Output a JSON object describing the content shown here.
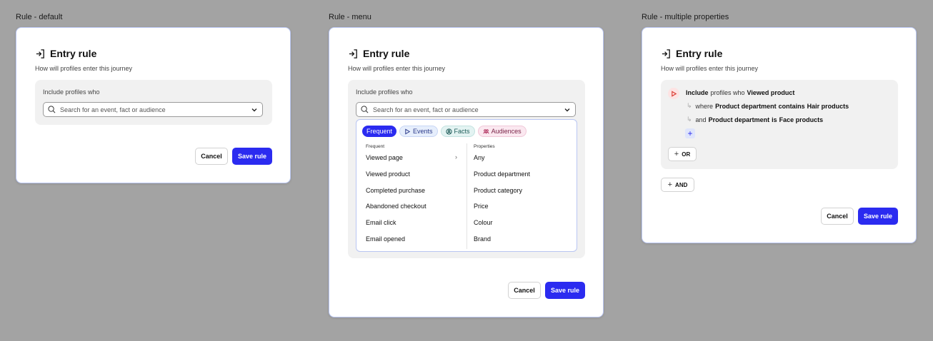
{
  "frames": [
    {
      "label": "Rule - default"
    },
    {
      "label": "Rule - menu"
    },
    {
      "label": "Rule - multiple properties"
    }
  ],
  "rule": {
    "title": "Entry rule",
    "subtitle": "How will profiles enter this journey",
    "include_label": "Include profiles who",
    "search_placeholder": "Search for an event, fact or audience",
    "cancel_label": "Cancel",
    "save_label": "Save rule"
  },
  "menu": {
    "chips": [
      "Frequent",
      "Events",
      "Facts",
      "Audiences"
    ],
    "left_heading": "Frequent",
    "right_heading": "Properties",
    "left_items": [
      "Viewed page",
      "Viewed product",
      "Completed purchase",
      "Abandoned checkout",
      "Email click",
      "Email opened"
    ],
    "right_items": [
      "Any",
      "Product department",
      "Product category",
      "Price",
      "Colour",
      "Brand"
    ],
    "arrow": "›"
  },
  "multi": {
    "include_word": "Include",
    "profiles_who": "profiles who",
    "event": "Viewed product",
    "cond1_prefix": "where",
    "cond1_prop": "Product department",
    "cond1_op": "contains",
    "cond1_value": "Hair products",
    "cond2_prefix": "and",
    "cond2_prop": "Product department",
    "cond2_op": "is",
    "cond2_value": "Face products",
    "or_label": "OR",
    "and_label": "AND"
  },
  "colors": {
    "primary": "#2b2bf0",
    "background": "#a3a3a3",
    "card_border": "#b9c6f2"
  }
}
